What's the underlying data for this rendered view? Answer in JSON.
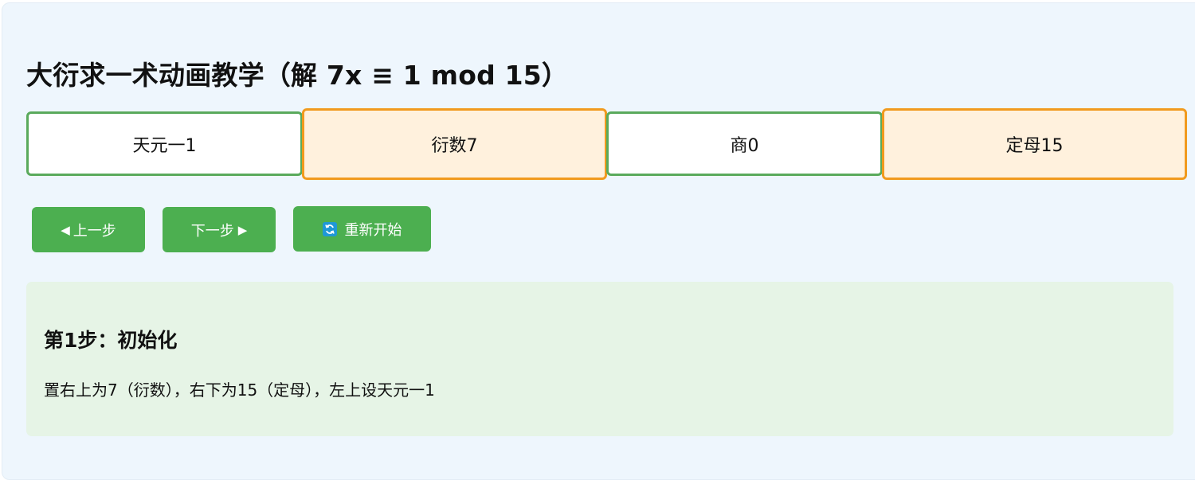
{
  "title": "大衍求一术动画教学（解 7x ≡ 1 mod 15）",
  "cells": [
    {
      "label": "天元一1"
    },
    {
      "label": "衍数7"
    },
    {
      "label": "商0"
    },
    {
      "label": "定母15"
    }
  ],
  "controls": {
    "prev_label": "上一步",
    "prev_icon": "◀",
    "next_label": "下一步",
    "next_icon": "▶",
    "restart_label": "重新开始",
    "restart_icon": "refresh-icon"
  },
  "step": {
    "title": "第1步：初始化",
    "description": "置右上为7（衍数），右下为15（定母），左上设天元一1"
  },
  "colors": {
    "panel_bg": "#eef6fd",
    "button": "#4caf50",
    "cell_border_green": "#5aaa5c",
    "cell_border_orange": "#f19a1e",
    "cell_bg_orange": "#fff1dd",
    "info_bg": "#e6f4e6"
  }
}
